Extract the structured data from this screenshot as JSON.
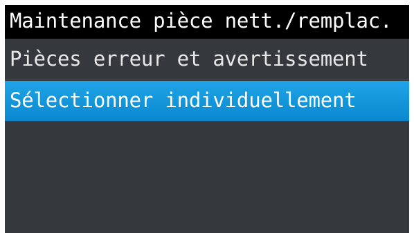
{
  "screen": {
    "title": "Maintenance pièce nett./remplac.",
    "menu_items": [
      {
        "label": "Pièces erreur et avertissement",
        "selected": false
      },
      {
        "label": "Sélectionner individuellement",
        "selected": true
      }
    ]
  },
  "colors": {
    "title_background": "#000000",
    "menu_background": "#35383d",
    "selection_highlight": "#1596da",
    "text": "#ffffff"
  }
}
